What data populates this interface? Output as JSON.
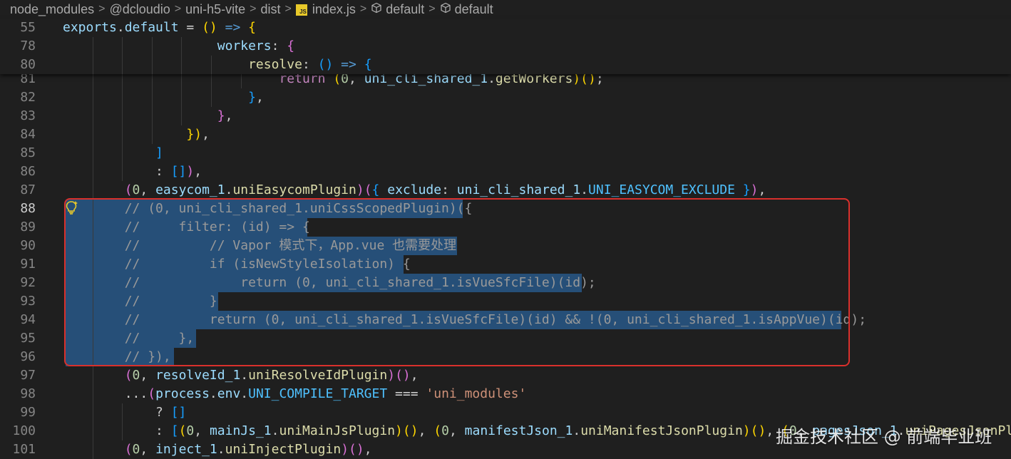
{
  "breadcrumb": [
    {
      "label": "node_modules",
      "icon": ""
    },
    {
      "label": "@dcloudio",
      "icon": ""
    },
    {
      "label": "uni-h5-vite",
      "icon": ""
    },
    {
      "label": "dist",
      "icon": ""
    },
    {
      "label": "index.js",
      "icon": "js-file-icon"
    },
    {
      "label": "default",
      "icon": "symbol-cube-icon"
    },
    {
      "label": "default",
      "icon": "symbol-cube-icon"
    }
  ],
  "breadcrumb_separator": ">",
  "js_icon_text": "JS",
  "colors": {
    "background": "#1f1f1f",
    "selection": "#264f78",
    "annotation_box": "#d9302c",
    "line_number": "#858585",
    "comment": "#999999"
  },
  "sticky_lines": [
    {
      "num": "55",
      "tokens": [
        [
          "exports",
          "var"
        ],
        [
          ".",
          "def"
        ],
        [
          "default",
          "var"
        ],
        [
          " = ",
          "op"
        ],
        [
          "()",
          "p1"
        ],
        [
          " => ",
          "kw"
        ],
        [
          "{",
          "p1"
        ]
      ]
    },
    {
      "num": "78",
      "tokens": [
        [
          "                    workers",
          "var"
        ],
        [
          ": ",
          "def"
        ],
        [
          "{",
          "p2"
        ]
      ]
    },
    {
      "num": "80",
      "tokens": [
        [
          "                        resolve",
          "fn"
        ],
        [
          ": ",
          "def"
        ],
        [
          "()",
          "p3"
        ],
        [
          " => ",
          "kw"
        ],
        [
          "{",
          "p3"
        ]
      ]
    }
  ],
  "code_lines": [
    {
      "num": "81",
      "tokens": [
        [
          "                            ",
          "def"
        ],
        [
          "return",
          "ctl"
        ],
        [
          " ",
          "def"
        ],
        [
          "(",
          "p1"
        ],
        [
          "0",
          "num"
        ],
        [
          ", ",
          "def"
        ],
        [
          "uni_cli_shared_1",
          "var"
        ],
        [
          ".",
          "def"
        ],
        [
          "getWorkers",
          "fn"
        ],
        [
          ")",
          "p1"
        ],
        [
          "()",
          "p1"
        ],
        [
          ";",
          "def"
        ]
      ]
    },
    {
      "num": "82",
      "tokens": [
        [
          "                        ",
          "def"
        ],
        [
          "}",
          "p3"
        ],
        [
          ",",
          "def"
        ]
      ]
    },
    {
      "num": "83",
      "tokens": [
        [
          "                    ",
          "def"
        ],
        [
          "}",
          "p2"
        ],
        [
          ",",
          "def"
        ]
      ]
    },
    {
      "num": "84",
      "tokens": [
        [
          "                ",
          "def"
        ],
        [
          "})",
          "p1"
        ],
        [
          ",",
          "def"
        ]
      ]
    },
    {
      "num": "85",
      "tokens": [
        [
          "            ",
          "def"
        ],
        [
          "]",
          "p3"
        ]
      ]
    },
    {
      "num": "86",
      "tokens": [
        [
          "            : ",
          "def"
        ],
        [
          "[]",
          "p3"
        ],
        [
          ")",
          "p2"
        ],
        [
          ",",
          "def"
        ]
      ]
    },
    {
      "num": "87",
      "tokens": [
        [
          "        ",
          "def"
        ],
        [
          "(",
          "p2"
        ],
        [
          "0",
          "num"
        ],
        [
          ", ",
          "def"
        ],
        [
          "easycom_1",
          "var"
        ],
        [
          ".",
          "def"
        ],
        [
          "uniEasycomPlugin",
          "fn"
        ],
        [
          ")",
          "p2"
        ],
        [
          "(",
          "p2"
        ],
        [
          "{",
          "p3"
        ],
        [
          " exclude",
          "var"
        ],
        [
          ": ",
          "def"
        ],
        [
          "uni_cli_shared_1",
          "var"
        ],
        [
          ".",
          "def"
        ],
        [
          "UNI_EASYCOM_EXCLUDE",
          "const"
        ],
        [
          " ",
          "def"
        ],
        [
          "}",
          "p3"
        ],
        [
          ")",
          "p2"
        ],
        [
          ",",
          "def"
        ]
      ]
    },
    {
      "num": "88",
      "tokens": [
        [
          "        // (0, uni_cli_shared_1.uniCssScopedPlugin)({",
          "cmt"
        ]
      ]
    },
    {
      "num": "89",
      "tokens": [
        [
          "        //     filter: (id) => {",
          "cmt"
        ]
      ]
    },
    {
      "num": "90",
      "tokens": [
        [
          "        //         // Vapor 模式下，App.vue 也需要处理",
          "cmt"
        ]
      ]
    },
    {
      "num": "91",
      "tokens": [
        [
          "        //         if (isNewStyleIsolation) {",
          "cmt"
        ]
      ]
    },
    {
      "num": "92",
      "tokens": [
        [
          "        //             return (0, uni_cli_shared_1.isVueSfcFile)(id);",
          "cmt"
        ]
      ]
    },
    {
      "num": "93",
      "tokens": [
        [
          "        //         }",
          "cmt"
        ]
      ]
    },
    {
      "num": "94",
      "tokens": [
        [
          "        //         return (0, uni_cli_shared_1.isVueSfcFile)(id) && !(0, uni_cli_shared_1.isAppVue)(id);",
          "cmt"
        ]
      ]
    },
    {
      "num": "95",
      "tokens": [
        [
          "        //     },",
          "cmt"
        ]
      ]
    },
    {
      "num": "96",
      "tokens": [
        [
          "        // }),",
          "cmt"
        ]
      ]
    },
    {
      "num": "97",
      "tokens": [
        [
          "        ",
          "def"
        ],
        [
          "(",
          "p2"
        ],
        [
          "0",
          "num"
        ],
        [
          ", ",
          "def"
        ],
        [
          "resolveId_1",
          "var"
        ],
        [
          ".",
          "def"
        ],
        [
          "uniResolveIdPlugin",
          "fn"
        ],
        [
          ")",
          "p2"
        ],
        [
          "()",
          "p2"
        ],
        [
          ",",
          "def"
        ]
      ]
    },
    {
      "num": "98",
      "tokens": [
        [
          "        ...",
          "op"
        ],
        [
          "(",
          "p2"
        ],
        [
          "process",
          "var"
        ],
        [
          ".",
          "def"
        ],
        [
          "env",
          "var"
        ],
        [
          ".",
          "def"
        ],
        [
          "UNI_COMPILE_TARGET",
          "const"
        ],
        [
          " === ",
          "op"
        ],
        [
          "'uni_modules'",
          "str"
        ]
      ]
    },
    {
      "num": "99",
      "tokens": [
        [
          "            ? ",
          "def"
        ],
        [
          "[]",
          "p3"
        ]
      ]
    },
    {
      "num": "100",
      "tokens": [
        [
          "            : ",
          "def"
        ],
        [
          "[",
          "p3"
        ],
        [
          "(",
          "p1"
        ],
        [
          "0",
          "num"
        ],
        [
          ", ",
          "def"
        ],
        [
          "mainJs_1",
          "var"
        ],
        [
          ".",
          "def"
        ],
        [
          "uniMainJsPlugin",
          "fn"
        ],
        [
          ")",
          "p1"
        ],
        [
          "()",
          "p1"
        ],
        [
          ", ",
          "def"
        ],
        [
          "(",
          "p1"
        ],
        [
          "0",
          "num"
        ],
        [
          ", ",
          "def"
        ],
        [
          "manifestJson_1",
          "var"
        ],
        [
          ".",
          "def"
        ],
        [
          "uniManifestJsonPlugin",
          "fn"
        ],
        [
          ")",
          "p1"
        ],
        [
          "()",
          "p1"
        ],
        [
          ", ",
          "def"
        ],
        [
          "(",
          "p1"
        ],
        [
          "0",
          "num"
        ],
        [
          ", ",
          "def"
        ],
        [
          "pagesJson_1",
          "var"
        ],
        [
          ".",
          "def"
        ],
        [
          "uniPagesJsonPlugin",
          "fn"
        ],
        [
          ")",
          "p1"
        ]
      ]
    },
    {
      "num": "101",
      "tokens": [
        [
          "        ",
          "def"
        ],
        [
          "(",
          "p2"
        ],
        [
          "0",
          "num"
        ],
        [
          ", ",
          "def"
        ],
        [
          "inject_1",
          "var"
        ],
        [
          ".",
          "def"
        ],
        [
          "uniInjectPlugin",
          "fn"
        ],
        [
          ")",
          "p2"
        ],
        [
          "()",
          "p2"
        ],
        [
          ",",
          "def"
        ]
      ]
    }
  ],
  "watermark": "掘金技术社区 @ 前端毕业班"
}
